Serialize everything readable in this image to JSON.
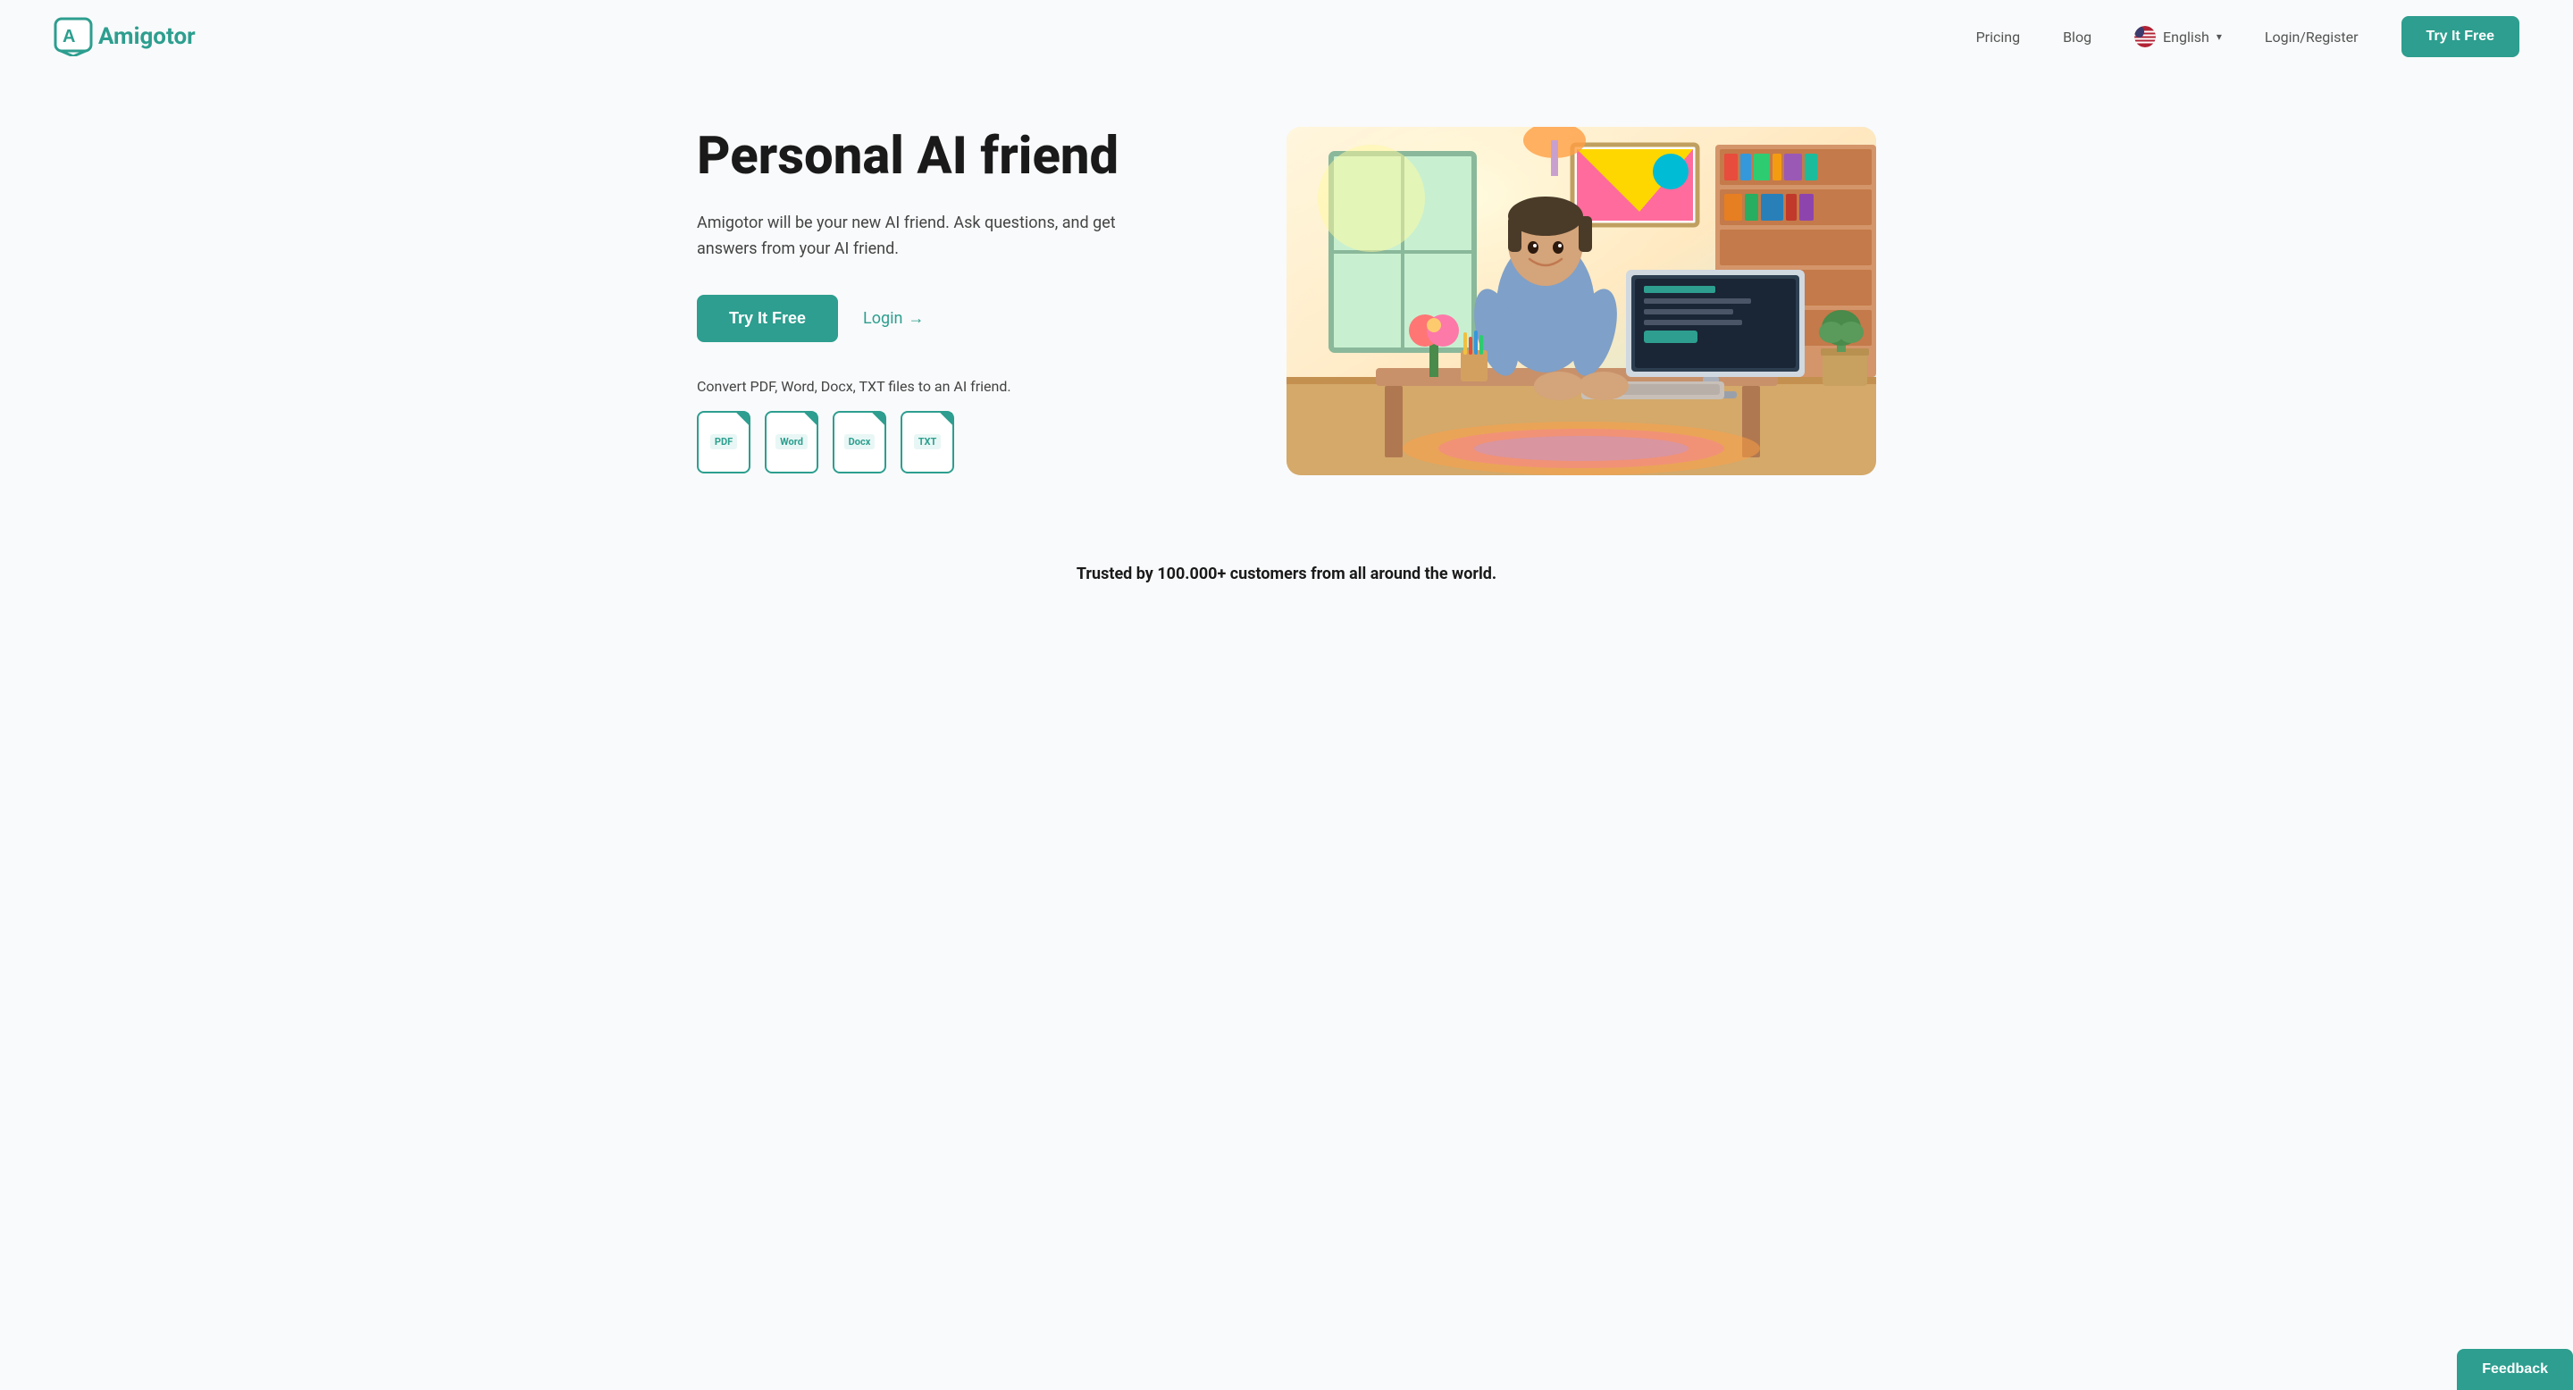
{
  "brand": {
    "name": "Amigotor",
    "logo_letter": "A",
    "accent_color": "#2d9e8f"
  },
  "navbar": {
    "pricing_label": "Pricing",
    "blog_label": "Blog",
    "language_label": "English",
    "login_register_label": "Login/Register",
    "try_it_free_label": "Try It Free"
  },
  "hero": {
    "title": "Personal AI friend",
    "subtitle": "Amigotor will be your new AI friend. Ask questions, and get answers from your AI friend.",
    "try_button_label": "Try It Free",
    "login_label": "Login",
    "login_arrow": "→",
    "convert_text": "Convert PDF, Word, Docx, TXT files to an AI friend.",
    "file_types": [
      "PDF",
      "Word",
      "Docx",
      "TXT"
    ]
  },
  "trusted": {
    "text": "Trusted by 100.000+ customers from all around the world."
  },
  "feedback": {
    "label": "Feedback"
  }
}
